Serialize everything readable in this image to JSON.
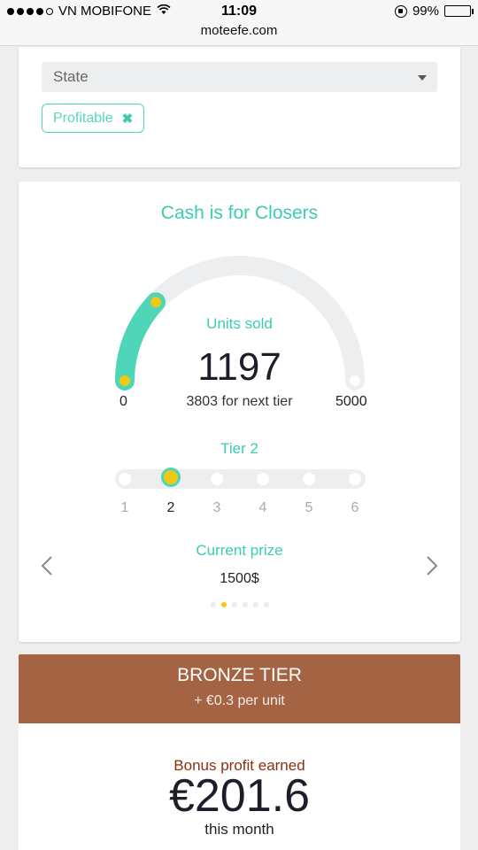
{
  "status_bar": {
    "carrier": "VN MOBIFONE",
    "time": "11:09",
    "battery": "99%",
    "battery_level": 0.99,
    "url": "moteefe.com"
  },
  "filters": {
    "state_select": {
      "value": "State"
    },
    "chips": [
      {
        "label": "Profitable"
      }
    ]
  },
  "goal": {
    "title": "Cash is for Closers",
    "units_label": "Units sold",
    "units_sold": "1197",
    "units_sold_value": 1197,
    "next_tier_text": "3803 for next tier",
    "gauge_min": "0",
    "gauge_max": "5000",
    "gauge_max_value": 5000,
    "tier_label": "Tier 2",
    "tiers": [
      "1",
      "2",
      "3",
      "4",
      "5",
      "6"
    ],
    "active_tier_index": 1,
    "prize_label": "Current prize",
    "prize_value": "1500$",
    "carousel_pages": 6,
    "carousel_active": 1
  },
  "tier_banner": {
    "name": "BRONZE TIER",
    "bonus": "+ €0.3 per unit",
    "color": "#a46443"
  },
  "bonus": {
    "label": "Bonus profit earned",
    "value": "€201.6",
    "period": "this month"
  },
  "colors": {
    "accent": "#3ccdb0",
    "highlight": "#f3c812"
  }
}
